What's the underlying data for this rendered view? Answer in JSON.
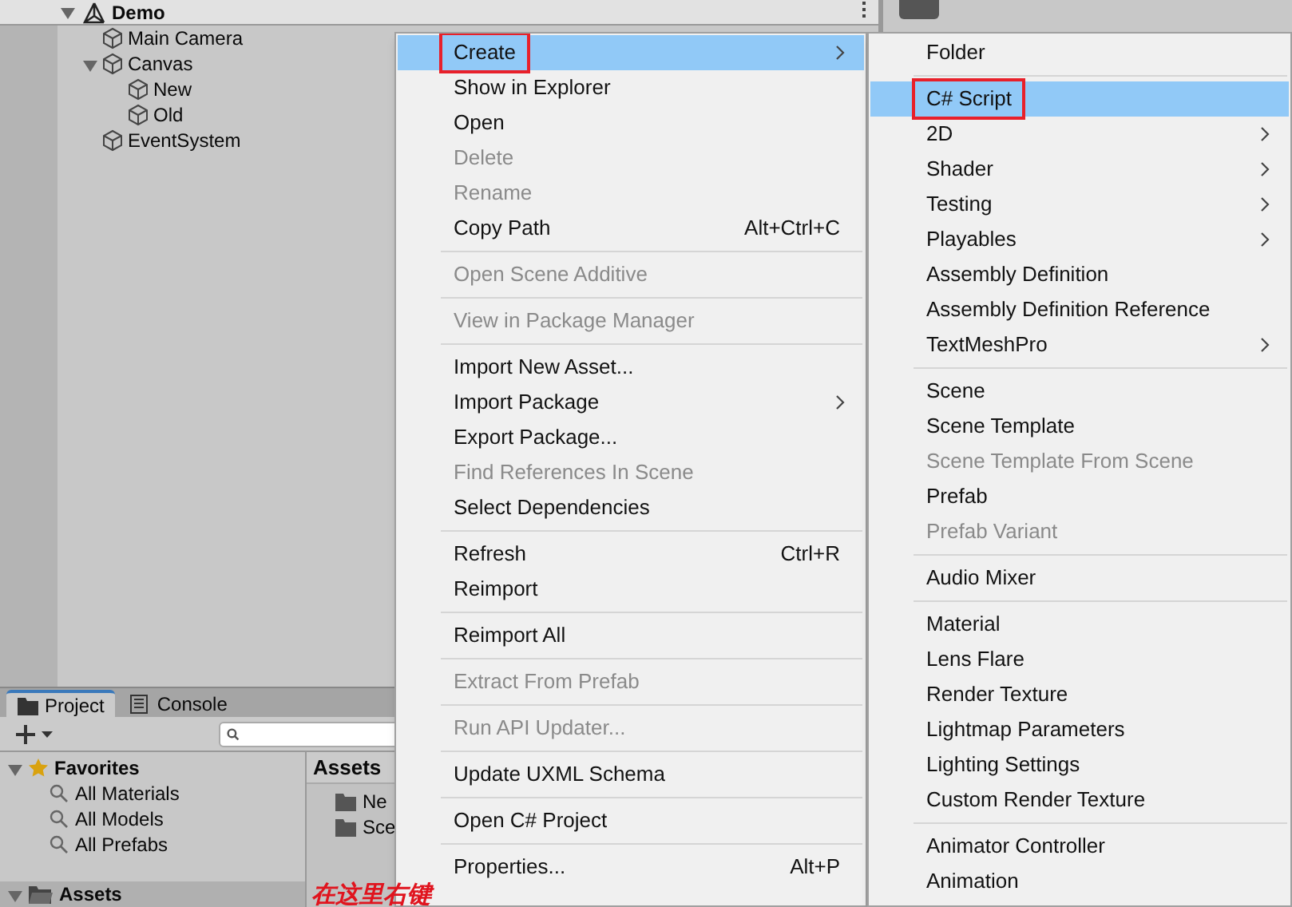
{
  "hierarchy": {
    "scene": {
      "label": "Demo",
      "expanded": true,
      "children": [
        {
          "label": "Main Camera"
        },
        {
          "label": "Canvas",
          "expanded": true,
          "children": [
            {
              "label": "New"
            },
            {
              "label": "Old"
            }
          ]
        },
        {
          "label": "EventSystem"
        }
      ]
    }
  },
  "project_panel": {
    "tabs": [
      {
        "label": "Project",
        "kind": "project",
        "selected": true
      },
      {
        "label": "Console",
        "kind": "console",
        "selected": false
      }
    ],
    "tree": [
      {
        "label": "Favorites",
        "kind": "favorites",
        "expanded": true,
        "selected": false,
        "children": [
          {
            "label": "All Materials",
            "kind": "search"
          },
          {
            "label": "All Models",
            "kind": "search"
          },
          {
            "label": "All Prefabs",
            "kind": "search"
          }
        ]
      },
      {
        "label": "Assets",
        "kind": "folder",
        "expanded": true,
        "selected": true
      }
    ],
    "breadcrumb": "Assets",
    "files": [
      "Ne",
      "Sce"
    ]
  },
  "context_menu": {
    "items": [
      {
        "kind": "item",
        "label": "Create",
        "disabled": false,
        "selected": true,
        "outlined": true,
        "submenu": true
      },
      {
        "kind": "item",
        "label": "Show in Explorer",
        "disabled": false,
        "selected": false,
        "outlined": false,
        "submenu": false
      },
      {
        "kind": "item",
        "label": "Open",
        "disabled": false,
        "selected": false,
        "outlined": false,
        "submenu": false
      },
      {
        "kind": "item",
        "label": "Delete",
        "disabled": true,
        "selected": false,
        "outlined": false,
        "submenu": false
      },
      {
        "kind": "item",
        "label": "Rename",
        "disabled": true,
        "selected": false,
        "outlined": false,
        "submenu": false
      },
      {
        "kind": "item",
        "label": "Copy Path",
        "shortcut": "Alt+Ctrl+C",
        "disabled": false,
        "selected": false,
        "outlined": false,
        "submenu": false
      },
      {
        "kind": "separator"
      },
      {
        "kind": "item",
        "label": "Open Scene Additive",
        "disabled": true,
        "selected": false,
        "outlined": false,
        "submenu": false
      },
      {
        "kind": "separator"
      },
      {
        "kind": "item",
        "label": "View in Package Manager",
        "disabled": true,
        "selected": false,
        "outlined": false,
        "submenu": false
      },
      {
        "kind": "separator"
      },
      {
        "kind": "item",
        "label": "Import New Asset...",
        "disabled": false,
        "selected": false,
        "outlined": false,
        "submenu": false
      },
      {
        "kind": "item",
        "label": "Import Package",
        "disabled": false,
        "selected": false,
        "outlined": false,
        "submenu": true
      },
      {
        "kind": "item",
        "label": "Export Package...",
        "disabled": false,
        "selected": false,
        "outlined": false,
        "submenu": false
      },
      {
        "kind": "item",
        "label": "Find References In Scene",
        "disabled": true,
        "selected": false,
        "outlined": false,
        "submenu": false
      },
      {
        "kind": "item",
        "label": "Select Dependencies",
        "disabled": false,
        "selected": false,
        "outlined": false,
        "submenu": false
      },
      {
        "kind": "separator"
      },
      {
        "kind": "item",
        "label": "Refresh",
        "shortcut": "Ctrl+R",
        "disabled": false,
        "selected": false,
        "outlined": false,
        "submenu": false
      },
      {
        "kind": "item",
        "label": "Reimport",
        "disabled": false,
        "selected": false,
        "outlined": false,
        "submenu": false
      },
      {
        "kind": "separator"
      },
      {
        "kind": "item",
        "label": "Reimport All",
        "disabled": false,
        "selected": false,
        "outlined": false,
        "submenu": false
      },
      {
        "kind": "separator"
      },
      {
        "kind": "item",
        "label": "Extract From Prefab",
        "disabled": true,
        "selected": false,
        "outlined": false,
        "submenu": false
      },
      {
        "kind": "separator"
      },
      {
        "kind": "item",
        "label": "Run API Updater...",
        "disabled": true,
        "selected": false,
        "outlined": false,
        "submenu": false
      },
      {
        "kind": "separator"
      },
      {
        "kind": "item",
        "label": "Update UXML Schema",
        "disabled": false,
        "selected": false,
        "outlined": false,
        "submenu": false
      },
      {
        "kind": "separator"
      },
      {
        "kind": "item",
        "label": "Open C# Project",
        "disabled": false,
        "selected": false,
        "outlined": false,
        "submenu": false
      },
      {
        "kind": "separator"
      },
      {
        "kind": "item",
        "label": "Properties...",
        "shortcut": "Alt+P",
        "disabled": false,
        "selected": false,
        "outlined": false,
        "submenu": false
      }
    ]
  },
  "create_submenu": {
    "items": [
      {
        "kind": "item",
        "label": "Folder",
        "disabled": false,
        "selected": false,
        "outlined": false,
        "submenu": false
      },
      {
        "kind": "separator"
      },
      {
        "kind": "item",
        "label": "C# Script",
        "disabled": false,
        "selected": true,
        "outlined": true,
        "submenu": false
      },
      {
        "kind": "item",
        "label": "2D",
        "disabled": false,
        "selected": false,
        "outlined": false,
        "submenu": true
      },
      {
        "kind": "item",
        "label": "Shader",
        "disabled": false,
        "selected": false,
        "outlined": false,
        "submenu": true
      },
      {
        "kind": "item",
        "label": "Testing",
        "disabled": false,
        "selected": false,
        "outlined": false,
        "submenu": true
      },
      {
        "kind": "item",
        "label": "Playables",
        "disabled": false,
        "selected": false,
        "outlined": false,
        "submenu": true
      },
      {
        "kind": "item",
        "label": "Assembly Definition",
        "disabled": false,
        "selected": false,
        "outlined": false,
        "submenu": false
      },
      {
        "kind": "item",
        "label": "Assembly Definition Reference",
        "disabled": false,
        "selected": false,
        "outlined": false,
        "submenu": false
      },
      {
        "kind": "item",
        "label": "TextMeshPro",
        "disabled": false,
        "selected": false,
        "outlined": false,
        "submenu": true
      },
      {
        "kind": "separator"
      },
      {
        "kind": "item",
        "label": "Scene",
        "disabled": false,
        "selected": false,
        "outlined": false,
        "submenu": false
      },
      {
        "kind": "item",
        "label": "Scene Template",
        "disabled": false,
        "selected": false,
        "outlined": false,
        "submenu": false
      },
      {
        "kind": "item",
        "label": "Scene Template From Scene",
        "disabled": true,
        "selected": false,
        "outlined": false,
        "submenu": false
      },
      {
        "kind": "item",
        "label": "Prefab",
        "disabled": false,
        "selected": false,
        "outlined": false,
        "submenu": false
      },
      {
        "kind": "item",
        "label": "Prefab Variant",
        "disabled": true,
        "selected": false,
        "outlined": false,
        "submenu": false
      },
      {
        "kind": "separator"
      },
      {
        "kind": "item",
        "label": "Audio Mixer",
        "disabled": false,
        "selected": false,
        "outlined": false,
        "submenu": false
      },
      {
        "kind": "separator"
      },
      {
        "kind": "item",
        "label": "Material",
        "disabled": false,
        "selected": false,
        "outlined": false,
        "submenu": false
      },
      {
        "kind": "item",
        "label": "Lens Flare",
        "disabled": false,
        "selected": false,
        "outlined": false,
        "submenu": false
      },
      {
        "kind": "item",
        "label": "Render Texture",
        "disabled": false,
        "selected": false,
        "outlined": false,
        "submenu": false
      },
      {
        "kind": "item",
        "label": "Lightmap Parameters",
        "disabled": false,
        "selected": false,
        "outlined": false,
        "submenu": false
      },
      {
        "kind": "item",
        "label": "Lighting Settings",
        "disabled": false,
        "selected": false,
        "outlined": false,
        "submenu": false
      },
      {
        "kind": "item",
        "label": "Custom Render Texture",
        "disabled": false,
        "selected": false,
        "outlined": false,
        "submenu": false
      },
      {
        "kind": "separator"
      },
      {
        "kind": "item",
        "label": "Animator Controller",
        "disabled": false,
        "selected": false,
        "outlined": false,
        "submenu": false
      },
      {
        "kind": "item",
        "label": "Animation",
        "disabled": false,
        "selected": false,
        "outlined": false,
        "submenu": false
      }
    ]
  },
  "annotation": "在这里右键"
}
